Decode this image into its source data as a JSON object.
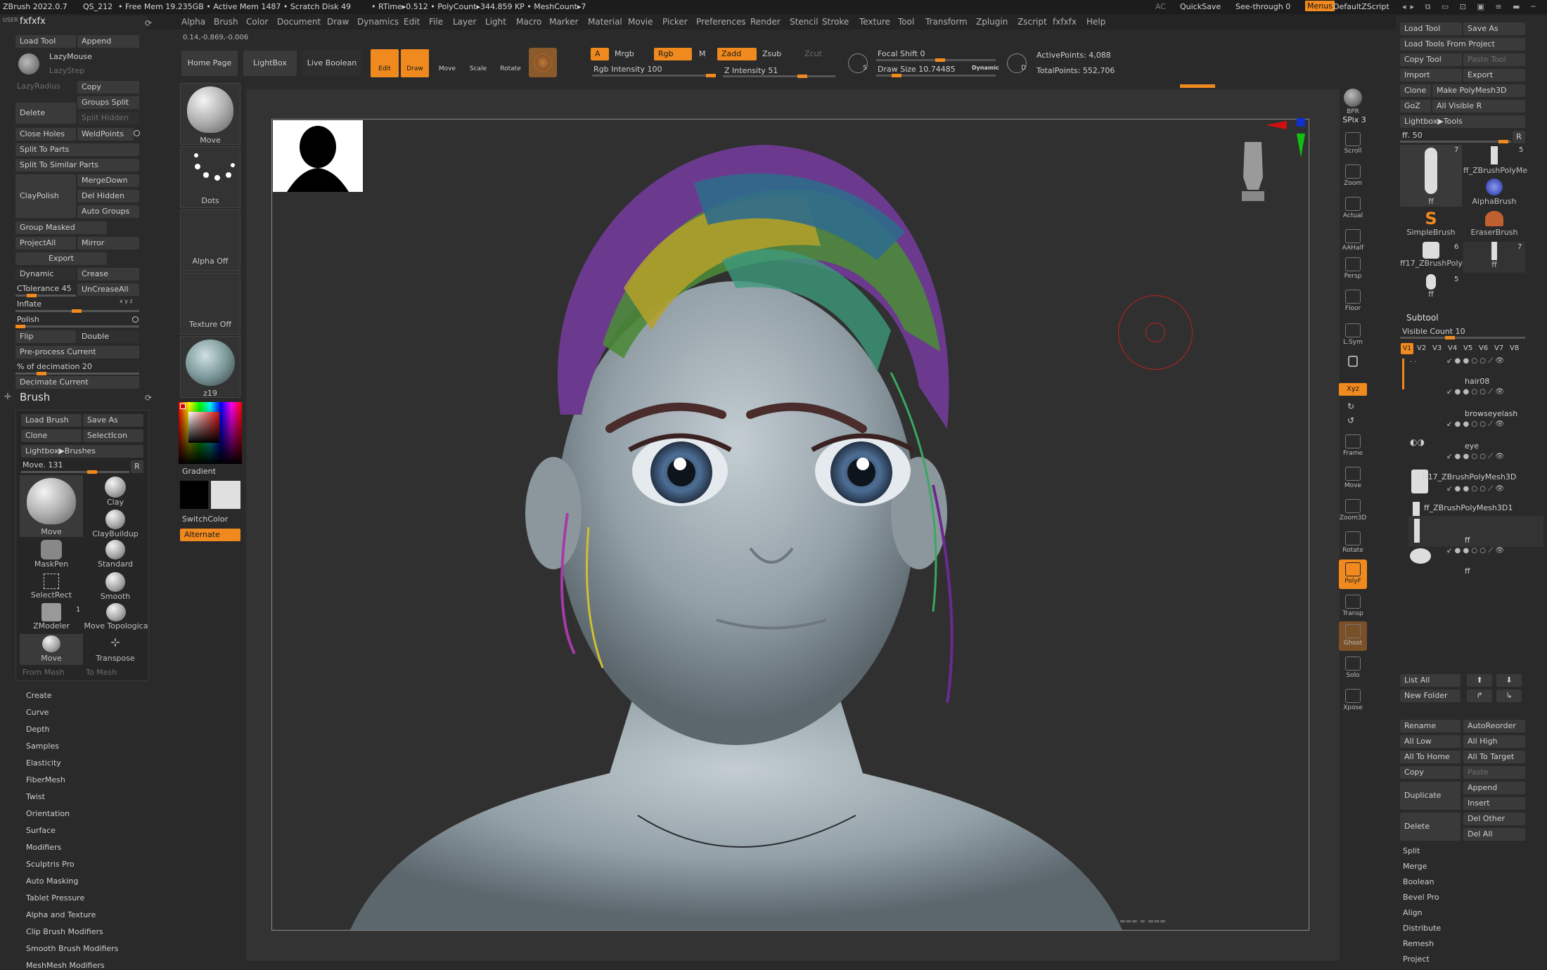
{
  "titlebar": {
    "app": "ZBrush 2022.0.7",
    "qs": "QS_212",
    "mem": "• Free Mem 19.235GB • Active Mem 1487 • Scratch Disk 49",
    "rtime": "• RTime▸0.512 • PolyCount▸344.859 KP • MeshCount▸7",
    "ac": "AC",
    "quicksave": "QuickSave",
    "seethrough": "See-through  0",
    "menus": "Menus",
    "script": "DefaultZScript"
  },
  "menubar": [
    "Alpha",
    "Brush",
    "Color",
    "Document",
    "Draw",
    "Dynamics",
    "Edit",
    "File",
    "Layer",
    "Light",
    "Macro",
    "Marker",
    "Material",
    "Movie",
    "Picker",
    "Preferences",
    "Render",
    "Stencil",
    "Stroke",
    "Texture",
    "Tool",
    "Transform",
    "Zplugin",
    "Zscript",
    "fxfxfx",
    "Help"
  ],
  "coords": "0.14,-0.869,-0.006",
  "shelf": {
    "home": "Home Page",
    "lightbox": "LightBox",
    "liveboolean": "Live Boolean",
    "edit": "Edit",
    "draw": "Draw",
    "move": "Move",
    "scale": "Scale",
    "rotate": "Rotate",
    "a": "A",
    "mrgb": "Mrgb",
    "rgb": "Rgb",
    "m": "M",
    "zadd": "Zadd",
    "zsub": "Zsub",
    "zcut": "Zcut",
    "rgbint": "Rgb Intensity 100",
    "zint": "Z Intensity 51",
    "focal": "Focal Shift 0",
    "drawsize": "Draw Size 10.74485",
    "dynamic": "Dynamic",
    "active": "ActivePoints: 4,088",
    "total": "TotalPoints: 552,706"
  },
  "left": {
    "panel_title": "fxfxfx",
    "rows": [
      {
        "l": "Load Tool",
        "r": "Append"
      },
      {
        "l": "",
        "r": "LazyMouse"
      },
      {
        "l": "",
        "r": "LazyStep"
      },
      {
        "l": "LazyRadius",
        "r": "Copy"
      },
      {
        "l": "Delete",
        "r": "Groups Split"
      },
      {
        "l": "",
        "r": "Split Hidden"
      },
      {
        "l": "Close Holes",
        "r": "WeldPoints"
      },
      {
        "l": "Split To Parts",
        "r": ""
      },
      {
        "l": "Split To Similar Parts",
        "r": ""
      },
      {
        "l": "ClayPolish",
        "r": "MergeDown"
      },
      {
        "l": "",
        "r": "Del Hidden"
      },
      {
        "l": "",
        "r": "Auto Groups"
      },
      {
        "l": "Group Masked",
        "r": ""
      },
      {
        "l": "ProjectAll",
        "r": "Mirror"
      },
      {
        "l": "Export",
        "r": ""
      },
      {
        "l": "Dynamic",
        "r": "Crease"
      },
      {
        "l": "CTolerance 45",
        "r": "UnCreaseAll"
      },
      {
        "l": "Inflate",
        "r": ""
      },
      {
        "l": "Polish",
        "r": ""
      },
      {
        "l": "Flip",
        "r": "Double"
      },
      {
        "l": "Pre-process Current",
        "r": ""
      },
      {
        "l": "% of decimation 20",
        "r": ""
      },
      {
        "l": "Decimate Current",
        "r": ""
      }
    ],
    "brush_title": "Brush",
    "brush_buttons": {
      "load": "Load Brush",
      "save": "Save As",
      "clone": "Clone",
      "selecticon": "SelectIcon",
      "lightbox": "Lightbox▶Brushes",
      "move_val": "Move. 131",
      "r": "R"
    },
    "brushes": [
      "Move",
      "Clay",
      "ClayBuildup",
      "MaskPen",
      "Standard",
      "SelectRect",
      "Smooth",
      "ZModeler",
      "Move Topologica",
      "Move",
      "Transpose"
    ],
    "zmodeler_count": "1",
    "from_mesh": "From Mesh",
    "to_mesh": "To Mesh",
    "sections": [
      "Create",
      "Curve",
      "Depth",
      "Samples",
      "Elasticity",
      "FiberMesh",
      "Twist",
      "Orientation",
      "Surface",
      "Modifiers",
      "Sculptris Pro",
      "Auto Masking",
      "Tablet Pressure",
      "Alpha and Texture",
      "Clip Brush Modifiers",
      "Smooth Brush Modifiers",
      "MeshMesh Modifiers"
    ]
  },
  "swatches": {
    "move": "Move",
    "dots": "Dots",
    "alpha": "Alpha Off",
    "texture": "Texture Off",
    "material": "z19",
    "gradient": "Gradient",
    "switchcolor": "SwitchColor",
    "alternate": "Alternate"
  },
  "rightstrip": [
    "BPR",
    "SPix 3",
    "Scroll",
    "Zoom",
    "Actual",
    "AAHalf",
    "Persp",
    "Floor",
    "L.Sym",
    "Xyz",
    "Frame",
    "Move",
    "Zoom3D",
    "Rotate",
    "PolyF",
    "Transp",
    "Ghost",
    "Solo",
    "Xpose"
  ],
  "right": {
    "buttons": [
      {
        "l": "Load Tool",
        "r": "Save As"
      },
      {
        "l": "Load Tools From Project",
        "r": ""
      },
      {
        "l": "Copy Tool",
        "r": "Paste Tool"
      },
      {
        "l": "Import",
        "r": "Export"
      },
      {
        "l": "Clone",
        "r": "Make PolyMesh3D"
      },
      {
        "l": "GoZ",
        "r": "All   Visible   R"
      },
      {
        "l": "Lightbox▶Tools",
        "r": ""
      },
      {
        "l": "ff. 50",
        "r": "R"
      }
    ],
    "tools": [
      {
        "n": "ff",
        "c": "7"
      },
      {
        "n": "ff_ZBrushPolyMe",
        "c": "5"
      },
      {
        "n": "AlphaBrush",
        "c": ""
      },
      {
        "n": "SimpleBrush",
        "c": ""
      },
      {
        "n": "EraserBrush",
        "c": ""
      },
      {
        "n": "ff17_ZBrushPolyl",
        "c": "6"
      },
      {
        "n": "ff",
        "c": "7"
      },
      {
        "n": "ff",
        "c": "5"
      }
    ],
    "subtool_title": "Subtool",
    "visible_count": "Visible Count 10",
    "views": [
      "V1",
      "V2",
      "V3",
      "V4",
      "V5",
      "V6",
      "V7",
      "V8"
    ],
    "subtools": [
      "",
      "hair08",
      "browseyelash",
      "eye",
      "ff17_ZBrushPolyMesh3D",
      "ff_ZBrushPolyMesh3D1",
      "ff",
      "ff"
    ],
    "listall": "List All",
    "newfolder": "New Folder",
    "actions": [
      {
        "l": "Rename",
        "r": "AutoReorder"
      },
      {
        "l": "All Low",
        "r": "All High"
      },
      {
        "l": "All To Home",
        "r": "All To Target"
      },
      {
        "l": "Copy",
        "r": "Paste"
      },
      {
        "l": "Duplicate",
        "r": "Append"
      },
      {
        "l": "",
        "r": "Insert"
      },
      {
        "l": "Delete",
        "r": "Del Other"
      },
      {
        "l": "",
        "r": "Del All"
      }
    ],
    "sections": [
      "Split",
      "Merge",
      "Boolean",
      "Bevel Pro",
      "Align",
      "Distribute",
      "Remesh",
      "Project"
    ]
  },
  "colors": {
    "accent": "#f0891e",
    "panel": "#2a2a2a",
    "canvas": "#303030"
  }
}
